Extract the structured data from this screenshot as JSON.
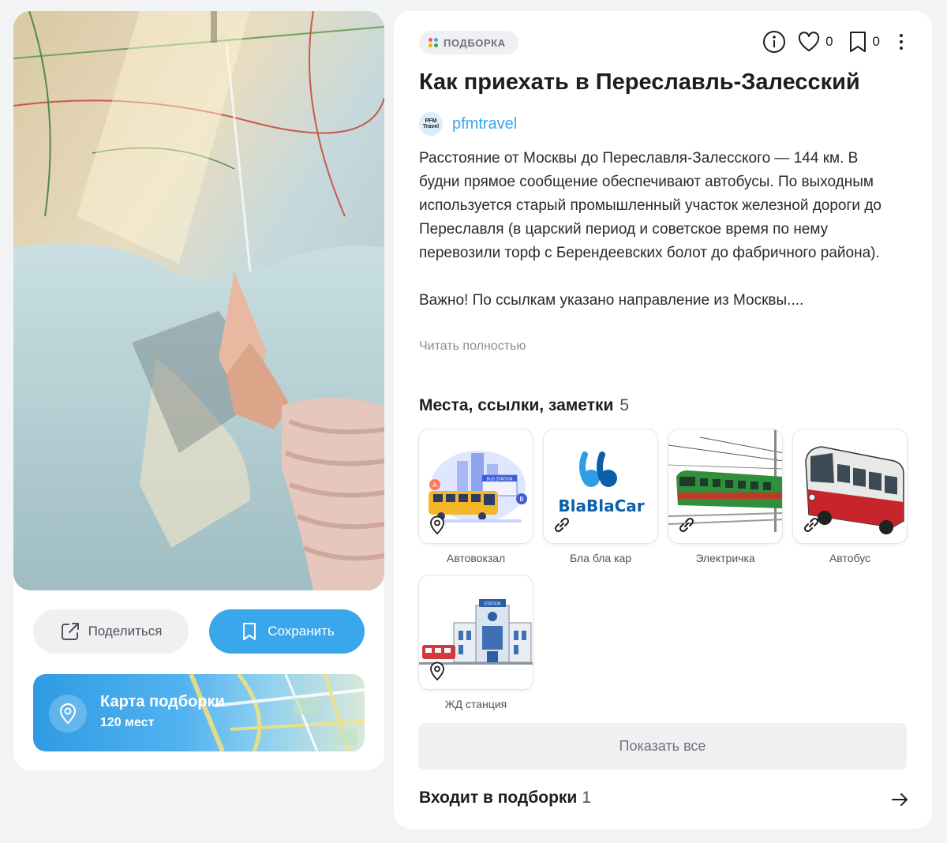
{
  "left": {
    "share_label": "Поделиться",
    "save_label": "Сохранить",
    "map": {
      "title": "Карта подборки",
      "subtitle": "120 мест"
    }
  },
  "right": {
    "tag_label": "ПОДБОРКА",
    "likes_count": "0",
    "bookmarks_count": "0",
    "title": "Как приехать в Переславль-Залесский",
    "author": {
      "name": "pfmtravel",
      "avatar_text": "PFM Travel"
    },
    "description": "Расстояние от Москвы до Переславля-Залесского — 144 км. В будни прямое сообщение обеспечивают автобусы. По выходным используется старый промышленный участок железной дороги до Переславля (в царский период и советское время по нему перевозили торф с Берендеевских болот до фабричного района).\n\nВажно! По ссылкам указано направление из Москвы....",
    "read_more": "Читать полностью",
    "section": {
      "title": "Места, ссылки, заметки",
      "count": "5"
    },
    "items": [
      {
        "caption": "Автовокзал",
        "type": "place"
      },
      {
        "caption": "Бла бла кар",
        "type": "link"
      },
      {
        "caption": "Электричка",
        "type": "link"
      },
      {
        "caption": "Автобус",
        "type": "link"
      },
      {
        "caption": "ЖД станция",
        "type": "place"
      }
    ],
    "show_all": "Показать все",
    "included": {
      "title": "Входит в подборки",
      "count": "1"
    },
    "blablacar_text": "BlaBlaCar",
    "bus_station_sign": "BUS STATION",
    "station_sign": "STATION"
  },
  "colors": {
    "accent": "#3aa7ec",
    "background": "#f2f3f5",
    "card": "#ffffff"
  }
}
